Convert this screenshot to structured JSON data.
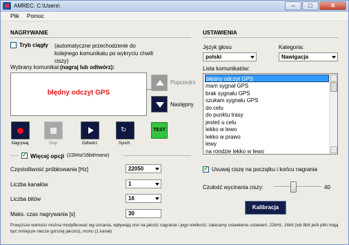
{
  "window": {
    "title": "AMREC: C:\\Users\\",
    "minimize": "–",
    "maximize": "□",
    "close": "✕"
  },
  "menu": [
    "Plik",
    "Pomoc"
  ],
  "left": {
    "section_title": "NAGRYWANIE",
    "continuous_label": "Tryb ciągły",
    "continuous_desc": "(automatyczne przechodzenie do kolejnego komunikatu po wykryciu chwili ciszy)",
    "continuous_checked": false,
    "selected_label": "Wybrany komunikat",
    "selected_hint": "(nagraj lub odtwórz):",
    "message": "błędny odczyt GPS",
    "prev_label": "Poprzedni",
    "next_label": "Następny",
    "buttons": [
      {
        "label": "Nagrywaj",
        "icon": "record-icon"
      },
      {
        "label": "Stop",
        "icon": "stop-icon"
      },
      {
        "label": "Odtwórz",
        "icon": "play-icon"
      },
      {
        "label": "Synch.",
        "icon": "sync-icon"
      },
      {
        "label": "TEST",
        "icon": "test-icon"
      }
    ],
    "more_options_label": "Więcej opcji",
    "more_options_checked": true,
    "more_options_desc": "(22kHz/16bit/mono)",
    "sample_rate_label": "Częstotliwość próbkowania [Hz]",
    "sample_rate": "22050",
    "channels_label": "Liczba kanałów",
    "channels": "1",
    "bits_label": "Liczba bitów",
    "bits": "16",
    "max_time_label": "Maks. czas nagrywania [s]",
    "max_time": "30"
  },
  "right": {
    "section_title": "USTAWIENIA",
    "voice_lang_label": "Język głosu",
    "voice_lang": "polski",
    "category_label": "Kategoria:",
    "category": "Nawigacja",
    "list_label": "Lista komunikatów:",
    "messages": [
      "błędny odczyt GPS",
      "mam sygnał GPS",
      "brak sygnału GPS",
      "szukam sygnału GPS",
      "do celu",
      "do punktu trasy",
      "jesteś u celu",
      "lekko w lewo",
      "lekko w prawo",
      "lewy",
      "na rondzie lekko w lewo"
    ],
    "trim_label": "Usuwaj ciszę na początku i końcu nagrania",
    "trim_checked": true,
    "sensitivity_label": "Czułość wycinania ciszy:",
    "sensitivity_value": "40",
    "calibrate_label": "Kalibracja"
  },
  "footer_note": "Powyższe wartości można modyfikować wg uznania, wpływają one na jakość nagrania i jego wielkość; zalecamy ustawienie ustawień: 22kHz, 16bit (lub 8bit jeśli pliki mają być mniejsze niecze gorszej jakości), mono (1 kanał)"
}
